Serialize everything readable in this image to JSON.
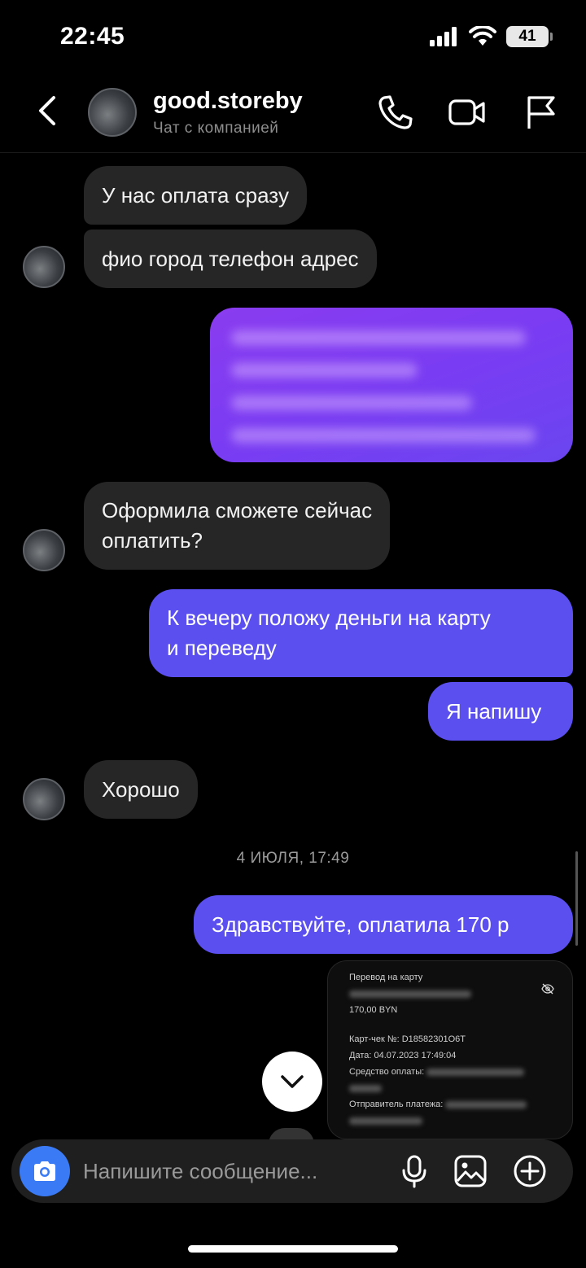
{
  "status_bar": {
    "time": "22:45",
    "battery": "41"
  },
  "header": {
    "name": "good.storeby",
    "subtitle": "Чат с компанией"
  },
  "messages": {
    "m1": "У нас оплата сразу",
    "m2": "фио город телефон адрес",
    "m4_line1": "Оформила сможете сейчас",
    "m4_line2": "оплатить?",
    "m5_line1": "К вечеру положу деньги на карту",
    "m5_line2": "и переведу",
    "m6": "Я напишу",
    "m7": "Хорошо",
    "date_separator": "4 ИЮЛЯ, 17:49",
    "m8": "Здравствуйте, оплатила 170 р"
  },
  "receipt": {
    "title": "Перевод на карту",
    "amount": "170,00 BYN",
    "check_no": "Карт-чек №: D18582301O6T",
    "date": "Дата: 04.07.2023 17:49:04",
    "payment_means": "Средство оплаты:",
    "sender": "Отправитель платежа:"
  },
  "composer": {
    "placeholder": "Напишите сообщение..."
  },
  "colors": {
    "outgoing": "#5b4ff0",
    "incoming": "#262626",
    "accent": "#3a7bf5"
  }
}
